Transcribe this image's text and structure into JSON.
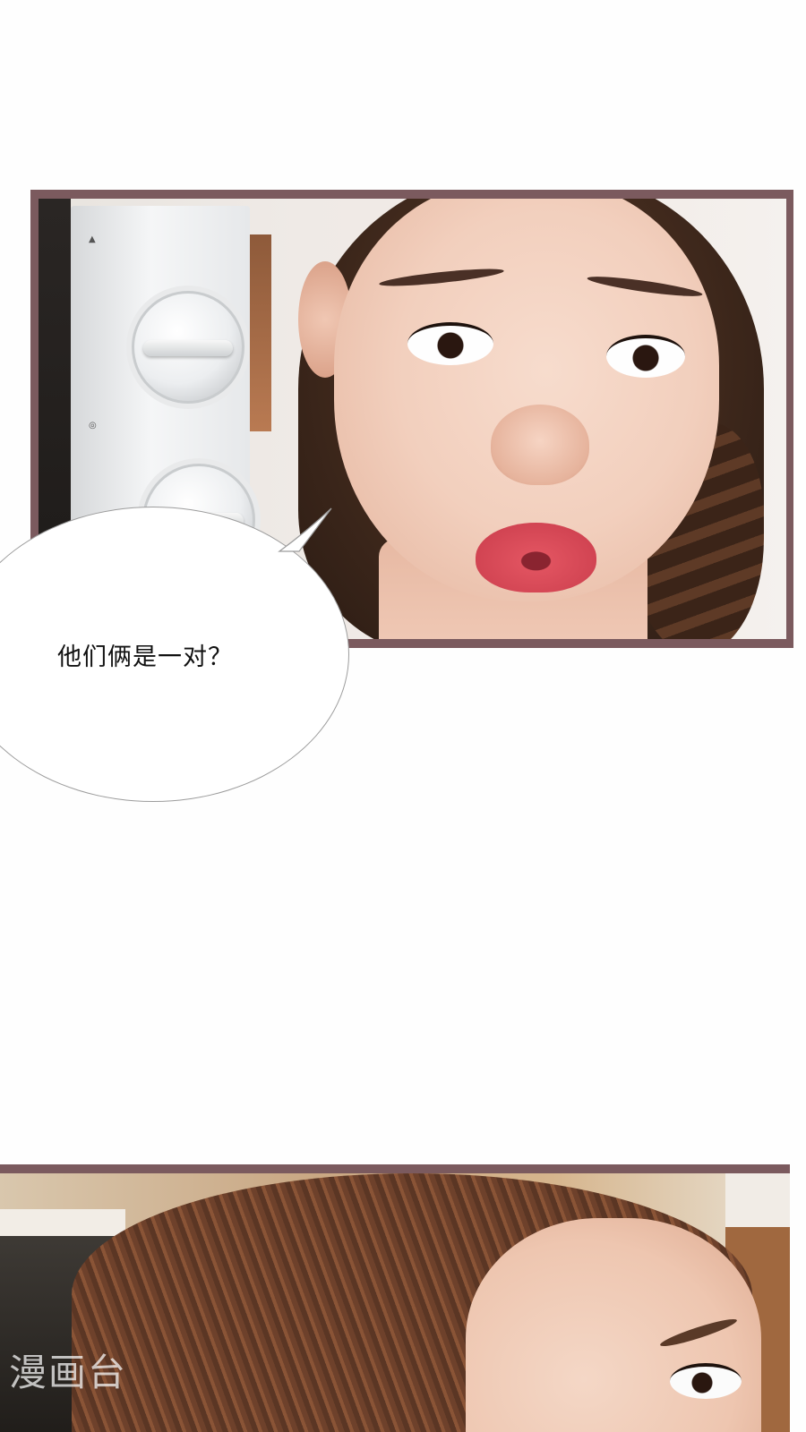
{
  "comic": {
    "panel1": {
      "description_label": "panel-1"
    },
    "speech_bubble": {
      "text": "他们俩是一对？"
    },
    "panel2": {
      "description_label": "panel-2"
    }
  },
  "watermark": {
    "text": "漫画台"
  },
  "colors": {
    "page_background": "#fefefe",
    "panel_border": "#7b5a5e",
    "bubble_border": "#9c9c9c",
    "watermark": "#ffffff"
  }
}
